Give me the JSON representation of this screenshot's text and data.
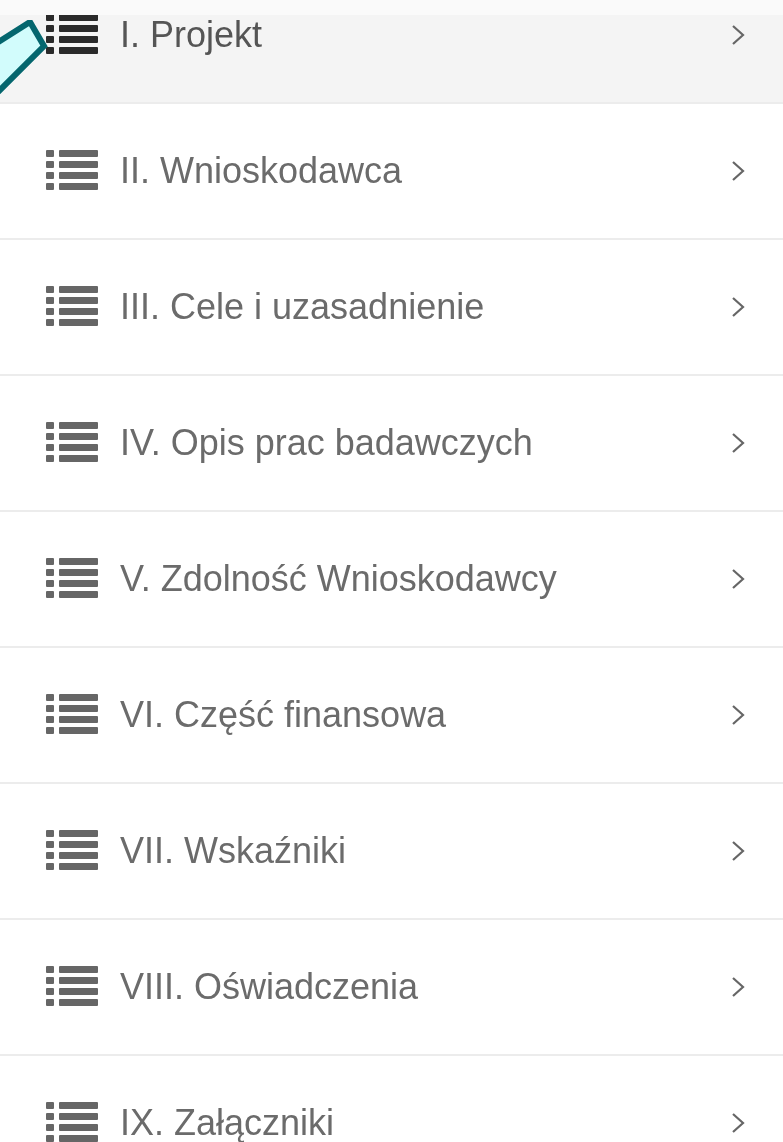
{
  "menu": {
    "items": [
      {
        "label": "I. Projekt",
        "selected": true
      },
      {
        "label": "II. Wnioskodawca",
        "selected": false
      },
      {
        "label": "III. Cele i uzasadnienie",
        "selected": false
      },
      {
        "label": "IV. Opis prac badawczych",
        "selected": false
      },
      {
        "label": "V. Zdolność Wnioskodawcy",
        "selected": false
      },
      {
        "label": "VI. Część finansowa",
        "selected": false
      },
      {
        "label": "VII. Wskaźniki",
        "selected": false
      },
      {
        "label": "VIII. Oświadczenia",
        "selected": false
      },
      {
        "label": "IX. Załączniki",
        "selected": false
      }
    ]
  }
}
